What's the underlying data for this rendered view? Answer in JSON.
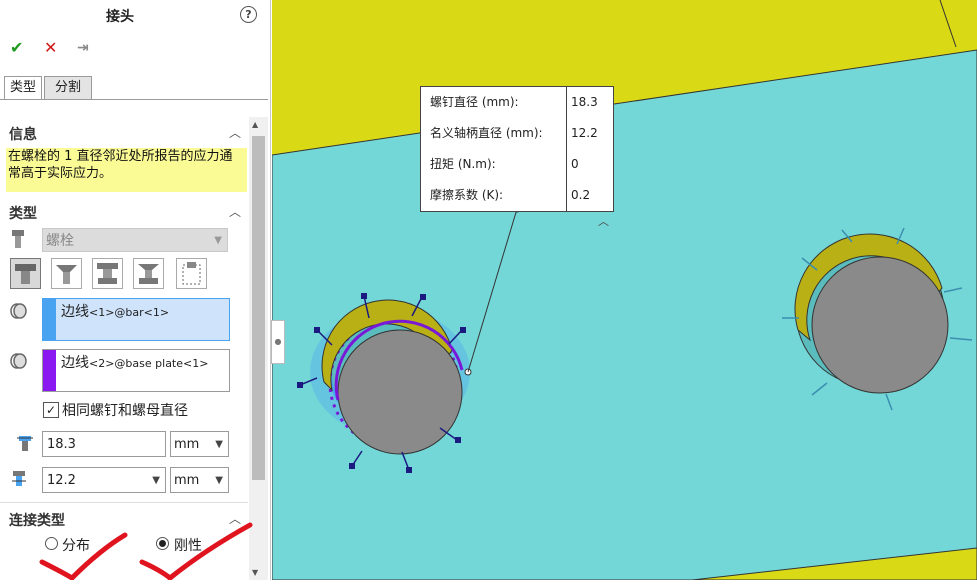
{
  "panel": {
    "title": "接头",
    "help": "?",
    "actions": {
      "ok": "✔",
      "cancel": "✕",
      "pin": "⇥"
    },
    "tabs": [
      "类型",
      "分割"
    ],
    "info": {
      "heading": "信息",
      "message": "在螺栓的 1 直径邻近处所报告的应力通常高于实际应力。"
    },
    "type_section": {
      "heading": "类型",
      "connector": "螺栓",
      "edge1": {
        "main": "边线",
        "sub": "<1>@bar<1>",
        "color": "#4aa3f0"
      },
      "edge2": {
        "main": "边线",
        "sub": "<2>@base plate<1>",
        "color": "#8a18f0"
      },
      "same_diameter_label": "相同螺钉和螺母直径",
      "same_diameter_checked": true,
      "head_diameter": "18.3",
      "head_unit": "mm",
      "shank_diameter": "12.2",
      "shank_unit": "mm"
    },
    "connection_section": {
      "heading": "连接类型",
      "options": [
        "分布",
        "刚性"
      ],
      "selected": "刚性"
    }
  },
  "callout": {
    "rows": [
      {
        "label": "螺钉直径 (mm):",
        "value": "18.3"
      },
      {
        "label": "名义轴柄直径 (mm):",
        "value": "12.2"
      },
      {
        "label": "扭矩 (N.m):",
        "value": "0"
      },
      {
        "label": "摩擦系数 (K):",
        "value": "0.2"
      }
    ]
  },
  "colors": {
    "plate": "#74d7d7",
    "bar": "#d9d916",
    "bolt_body": "#8a8a8a",
    "bolt_ring": "#b8b014",
    "selection_blue": "#4aa3f0",
    "selection_purple": "#7a18d8",
    "annotation_red": "#e0141e"
  }
}
